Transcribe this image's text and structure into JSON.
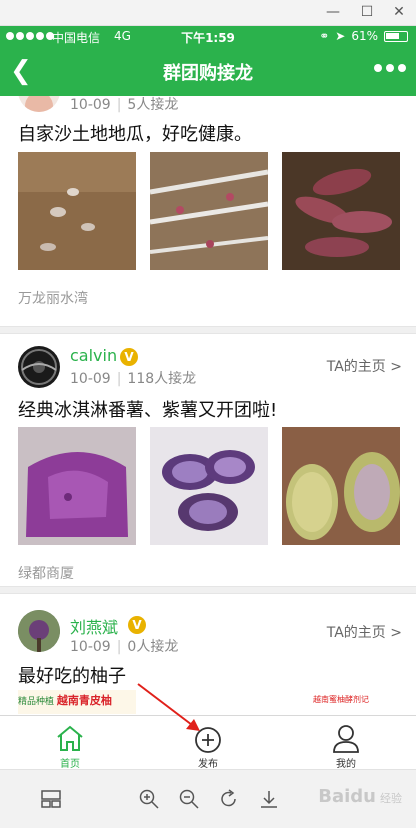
{
  "status": {
    "carrier": "中国电信",
    "network": "4G",
    "time": "下午1:59",
    "battery": "61%"
  },
  "nav": {
    "title": "群团购接龙"
  },
  "posts": [
    {
      "name": "",
      "date": "10-09",
      "count": "5人接龙",
      "title": "自家沙土地地瓜，好吃健康。",
      "location": "万龙丽水湾",
      "home_link": ""
    },
    {
      "name": "calvin",
      "date": "10-09",
      "count": "118人接龙",
      "title": "经典冰淇淋番薯、紫薯又开团啦!",
      "location": "绿都商厦",
      "home_link": "TA的主页 >"
    },
    {
      "name": "刘燕斌",
      "date": "10-09",
      "count": "0人接龙",
      "title": "最好吃的柚子",
      "location": "",
      "home_link": "TA的主页 >",
      "pic_texts": [
        "精品种植",
        "越南青皮柚",
        "越南蜜柚酵剂记"
      ]
    }
  ],
  "verified_badge": "V",
  "tabs": [
    {
      "label": "首页",
      "icon": "home-icon",
      "active": true
    },
    {
      "label": "发布",
      "icon": "add-circle-icon",
      "active": false
    },
    {
      "label": "我的",
      "icon": "user-icon",
      "active": false
    }
  ],
  "viewer": {
    "watermark": "Baidu",
    "watermark_sub": "经验"
  },
  "colors": {
    "brand_green": "#2bb24c",
    "badge_gold": "#e9b200",
    "annotation_red": "#e0201a"
  }
}
